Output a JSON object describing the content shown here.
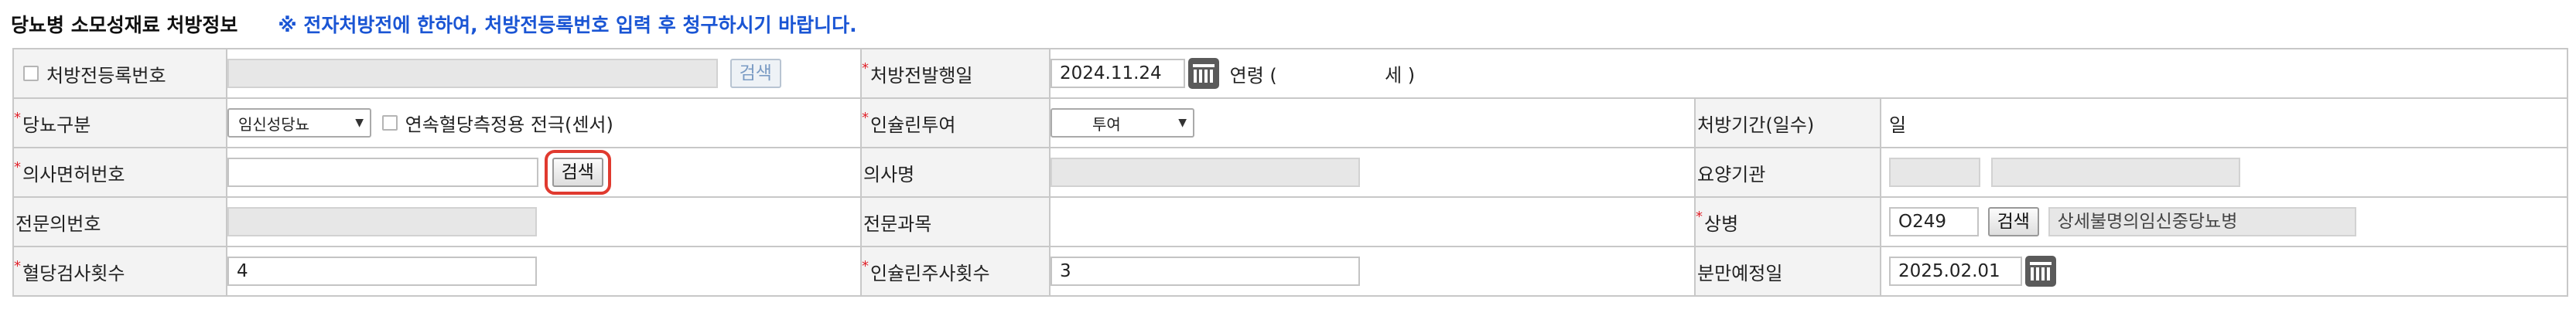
{
  "header": {
    "title": "당뇨병 소모성재료 처방정보",
    "notice": "※ 전자처방전에 한하여, 처방전등록번호 입력 후 청구하시기 바랍니다."
  },
  "row1": {
    "reg_no_label": "처방전등록번호",
    "reg_no_value": "",
    "reg_search_btn": "검색",
    "issue_date_label": "처방전발행일",
    "issue_date_value": "2024.11.24",
    "age_prefix": "연령 (",
    "age_value": "",
    "age_suffix": "세 )"
  },
  "row2": {
    "diabetes_type_label": "당뇨구분",
    "diabetes_type_value": "임신성당뇨",
    "cgm_label": "연속혈당측정용 전극(센서)",
    "insulin_label": "인슐린투여",
    "insulin_value": "투여",
    "period_label": "처방기간(일수)",
    "period_unit": "일"
  },
  "row3": {
    "license_label": "의사면허번호",
    "license_value": "",
    "license_search_btn": "검색",
    "doctor_name_label": "의사명",
    "doctor_name_value": "",
    "institution_label": "요양기관",
    "institution_code": "",
    "institution_name": ""
  },
  "row4": {
    "specialist_no_label": "전문의번호",
    "specialist_no_value": "",
    "specialty_label": "전문과목",
    "specialty_value": "",
    "disease_label": "상병",
    "disease_code": "O249",
    "disease_search_btn": "검색",
    "disease_name": "상세불명의임신중당뇨병"
  },
  "row5": {
    "glucose_test_label": "혈당검사횟수",
    "glucose_test_value": "4",
    "insulin_injections_label": "인슐린주사횟수",
    "insulin_injections_value": "3",
    "due_date_label": "분만예정일",
    "due_date_value": "2025.02.01"
  },
  "icons": {
    "calendar": "calendar-icon",
    "dropdown": "chevron-down-icon",
    "required": "asterisk"
  },
  "colors": {
    "notice_blue": "#1a55d4",
    "required_red": "#e0222a",
    "highlight_red": "#e03a2f",
    "label_bg": "#f3f3f3"
  }
}
